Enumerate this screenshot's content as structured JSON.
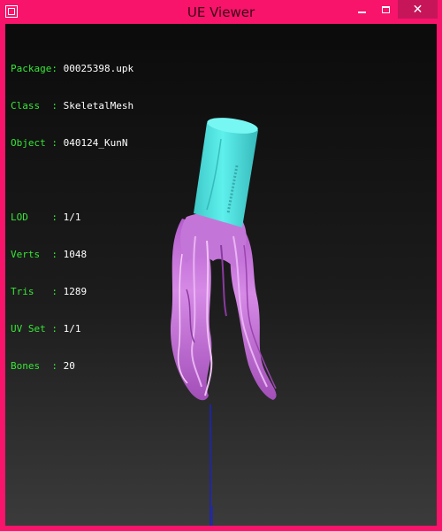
{
  "window": {
    "title": "UE Viewer",
    "controls": {
      "minimize": "minimize",
      "maximize": "maximize",
      "close": "close"
    }
  },
  "info": {
    "package_label": "Package: ",
    "package_value": "00025398.upk",
    "class_label": "Class  : ",
    "class_value": "SkeletalMesh",
    "object_label": "Object : ",
    "object_value": "040124_KunN",
    "lod_label": "LOD    : ",
    "lod_value": "1/1",
    "verts_label": "Verts  : ",
    "verts_value": "1048",
    "tris_label": "Tris   : ",
    "tris_value": "1289",
    "uvset_label": "UV Set : ",
    "uvset_value": "1/1",
    "bones_label": "Bones  : ",
    "bones_value": "20"
  },
  "colors": {
    "frame": "#f7146a",
    "label_green": "#37e637",
    "mesh_cyan": "#4de3e0",
    "hair_purple": "#c87ad8",
    "axis_blue": "#1a22c8"
  },
  "icons": [
    "window-icon",
    "minimize-icon",
    "maximize-icon",
    "close-icon"
  ]
}
